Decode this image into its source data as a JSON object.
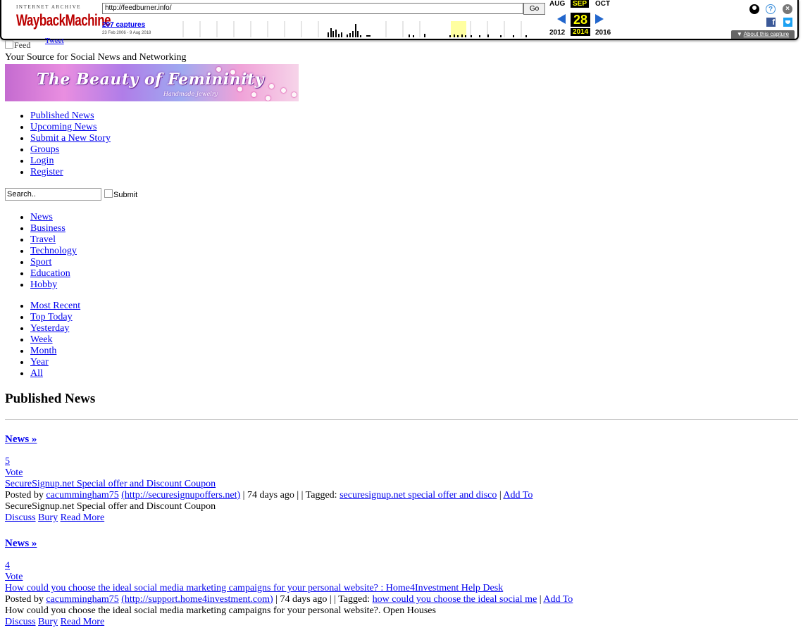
{
  "wayback": {
    "brand_top": "INTERNET ARCHIVE",
    "brand_logo": "WaybackMachine",
    "url": "http://feedburner.info/",
    "go_label": "Go",
    "captures": "207 captures",
    "range": "23 Feb 2006 - 9 Aug 2018",
    "month_prev": "AUG",
    "month_cur": "SEP",
    "month_next": "OCT",
    "day": "28",
    "year_prev": "2012",
    "year_cur": "2014",
    "year_next": "2016",
    "help_glyph": "?",
    "close_glyph": "×",
    "facebook_glyph": "f",
    "about": "About this capture",
    "about_arrow": "▼",
    "accent": "#2266cc"
  },
  "header": {
    "feed_alt": "Feed",
    "tweet": "Tweet",
    "tagline": "Your Source for Social News and Networking",
    "banner_title": "The Beauty of Femininity",
    "banner_sub": "Handmade Jewelry"
  },
  "main_nav": [
    "Published News",
    "Upcoming News",
    "Submit a New Story",
    "Groups",
    "Login",
    "Register"
  ],
  "search": {
    "value": "Search..",
    "submit": "Submit"
  },
  "categories": [
    "News",
    "Business",
    "Travel",
    "Technology",
    "Sport",
    "Education",
    "Hobby"
  ],
  "time_filters": [
    "Most Recent",
    "Top Today",
    "Yesterday",
    "Week",
    "Month",
    "Year",
    "All"
  ],
  "section_title": "Published News",
  "stories": [
    {
      "category": "News »",
      "votes": "5",
      "vote_label": "Vote",
      "title": "SecureSignup.net Special offer and Discount Coupon",
      "posted_by": "Posted by",
      "author": "cacummingham75",
      "url": "(http://securesignupoffers.net)",
      "age": "| 74 days ago | | Tagged:",
      "tags": "securesignup.net special offer and disco",
      "sep": "|",
      "add_to": "Add To",
      "summary": "SecureSignup.net Special offer and Discount Coupon",
      "discuss": "Discuss",
      "bury": "Bury",
      "read_more": "Read More"
    },
    {
      "category": "News »",
      "votes": "4",
      "vote_label": "Vote",
      "title": "How could you choose the ideal social media marketing campaigns for your personal website? : Home4Investment Help Desk",
      "posted_by": "Posted by",
      "author": "cacummingham75",
      "url": "(http://support.home4investment.com)",
      "age": "| 74 days ago | | Tagged:",
      "tags": "how could you choose the ideal social me",
      "sep": "|",
      "add_to": "Add To",
      "summary": "How could you choose the ideal social media marketing campaigns for your personal website?. Open Houses",
      "discuss": "Discuss",
      "bury": "Bury",
      "read_more": "Read More"
    }
  ]
}
